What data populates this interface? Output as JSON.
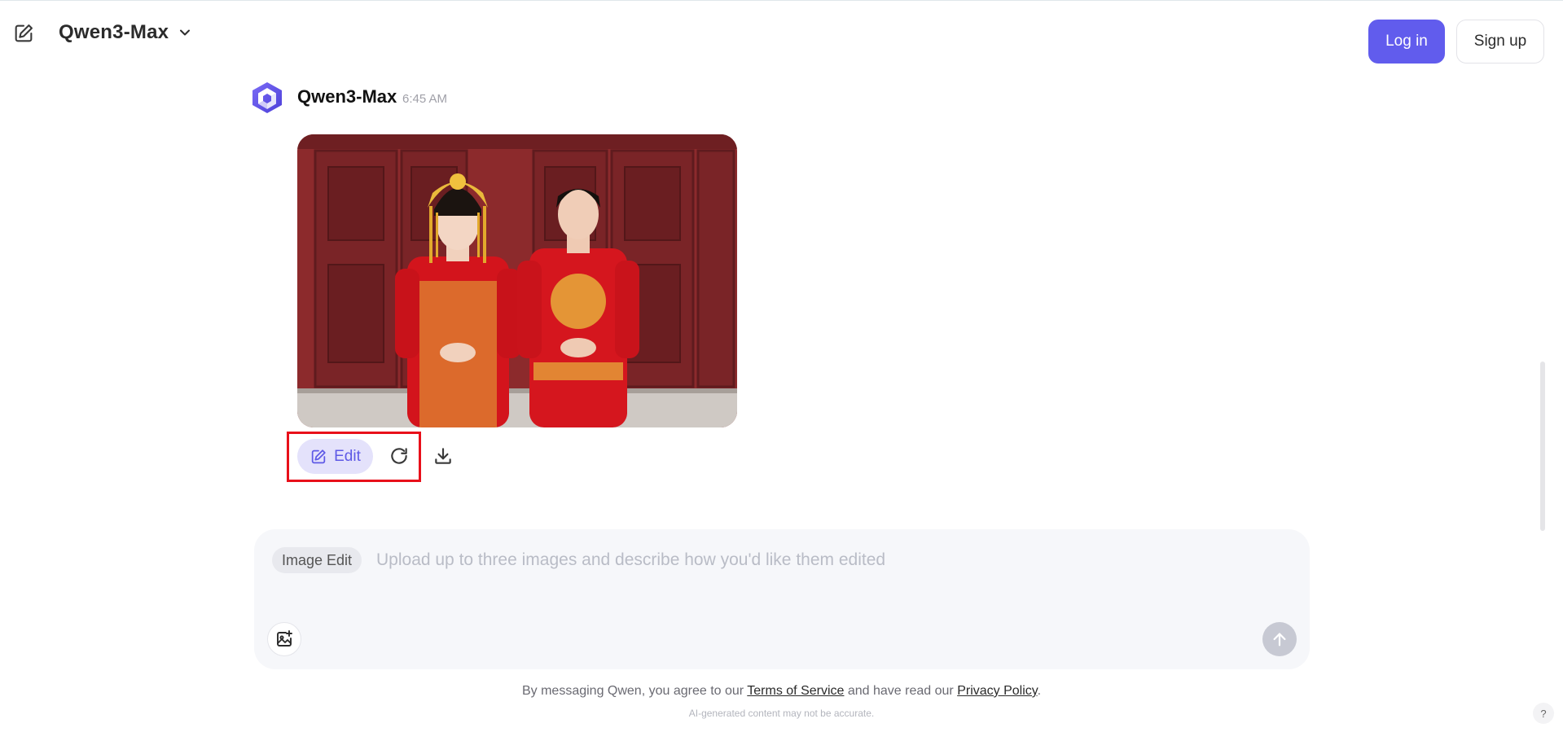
{
  "header": {
    "model_name": "Qwen3-Max",
    "login_label": "Log in",
    "signup_label": "Sign up"
  },
  "message": {
    "author": "Qwen3-Max",
    "time": "6:45 AM",
    "actions": {
      "edit_label": "Edit"
    }
  },
  "composer": {
    "mode_chip": "Image Edit",
    "placeholder": "Upload up to three images and describe how you'd like them edited"
  },
  "footer": {
    "terms_prefix": "By messaging Qwen, you agree to our ",
    "terms_link": "Terms of Service",
    "terms_middle": " and have read our ",
    "privacy_link": "Privacy Policy",
    "terms_suffix": ".",
    "disclaimer": "AI-generated content may not be accurate.",
    "help_label": "?"
  },
  "colors": {
    "accent": "#615ced",
    "highlight": "#e8101a"
  },
  "icons": {
    "new_chat": "edit-square-icon",
    "model_dropdown": "chevron-down-icon",
    "edit": "edit-icon",
    "regenerate": "refresh-icon",
    "download": "download-icon",
    "upload_image": "image-add-icon",
    "send": "arrow-up-icon"
  }
}
